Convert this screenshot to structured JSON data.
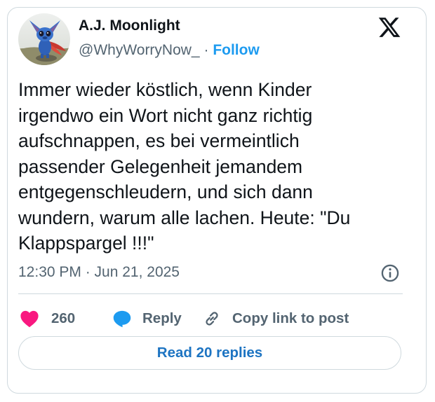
{
  "author": {
    "display_name": "A.J. Moonlight",
    "handle": "@WhyWorryNow_",
    "separator": "·",
    "follow_label": "Follow"
  },
  "tweet": {
    "text": "Immer wieder köstlich, wenn Kinder\nirgendwo ein Wort nicht ganz richtig\naufschnappen, es bei vermeintlich\npassender Gelegenheit jemandem\nentgegenschleudern, und sich dann\nwundern, warum alle lachen. Heute: \"Du\nKlappspargel !!!\"",
    "timestamp": "12:30 PM · Jun 21, 2025"
  },
  "actions": {
    "like_count": "260",
    "reply_label": "Reply",
    "copy_link_label": "Copy link to post",
    "read_replies_label": "Read 20 replies"
  },
  "icons": {
    "brand": "x-logo-icon",
    "info": "info-icon",
    "like": "heart-icon",
    "reply": "reply-bubble-icon",
    "copy_link": "link-icon"
  },
  "colors": {
    "link_blue": "#1d9bf0",
    "heart_pink": "#f91880",
    "text_primary": "#0f1419",
    "text_secondary": "#536471",
    "border": "#cfd9de"
  }
}
